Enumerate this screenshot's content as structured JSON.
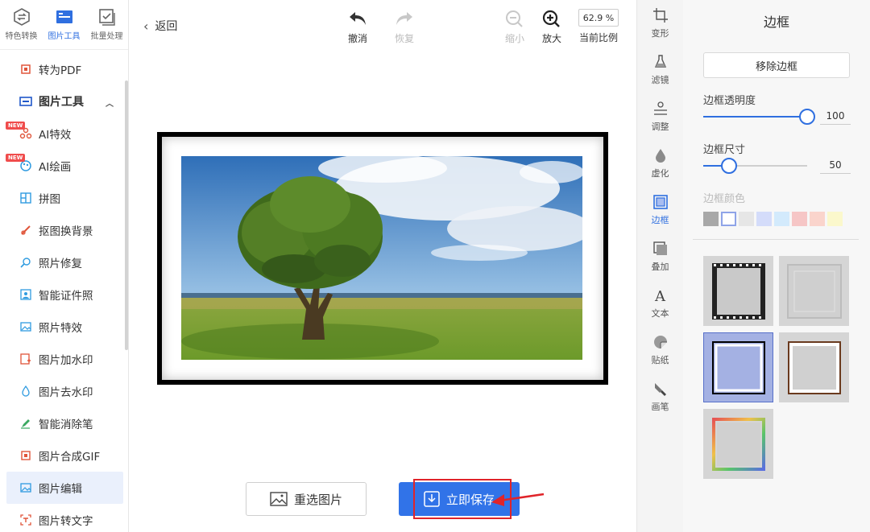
{
  "sidebar": {
    "top_tabs": [
      {
        "label": "特色转换",
        "icon": "convert-icon"
      },
      {
        "label": "图片工具",
        "icon": "image-tool-icon"
      },
      {
        "label": "批量处理",
        "icon": "batch-icon"
      }
    ],
    "items": [
      {
        "label": "转为PDF"
      },
      {
        "label": "图片工具"
      },
      {
        "label": "AI特效",
        "badge": "NEW"
      },
      {
        "label": "AI绘画",
        "badge": "NEW"
      },
      {
        "label": "拼图"
      },
      {
        "label": "抠图换背景"
      },
      {
        "label": "照片修复"
      },
      {
        "label": "智能证件照"
      },
      {
        "label": "照片特效"
      },
      {
        "label": "图片加水印"
      },
      {
        "label": "图片去水印"
      },
      {
        "label": "智能消除笔"
      },
      {
        "label": "图片合成GIF"
      },
      {
        "label": "图片编辑"
      },
      {
        "label": "图片转文字"
      }
    ]
  },
  "toolbar": {
    "back": "返回",
    "undo": "撤消",
    "redo": "恢复",
    "zoom_out": "缩小",
    "zoom_in": "放大",
    "zoom_value": "62.9 %",
    "zoom_label": "当前比例"
  },
  "canvas": {
    "reselect": "重选图片",
    "save": "立即保存"
  },
  "tools": [
    {
      "label": "变形",
      "icon": "transform-icon"
    },
    {
      "label": "滤镜",
      "icon": "filter-icon"
    },
    {
      "label": "调整",
      "icon": "adjust-icon"
    },
    {
      "label": "虚化",
      "icon": "blur-icon"
    },
    {
      "label": "边框",
      "icon": "border-icon"
    },
    {
      "label": "叠加",
      "icon": "overlay-icon"
    },
    {
      "label": "文本",
      "icon": "text-icon"
    },
    {
      "label": "贴纸",
      "icon": "sticker-icon"
    },
    {
      "label": "画笔",
      "icon": "brush-icon"
    }
  ],
  "panel": {
    "title": "边框",
    "remove": "移除边框",
    "opacity_label": "边框透明度",
    "opacity_value": "100",
    "opacity_level": 1.0,
    "size_label": "边框尺寸",
    "size_value": "50",
    "size_level": 0.25,
    "color_label": "边框颜色",
    "colors": [
      "#a8a8a8",
      "#ffffff",
      "#e6e6e6",
      "#d4dcfa",
      "#d3eafc",
      "#f6c6c6",
      "#fad4cc",
      "#fbf8cc"
    ]
  },
  "colors": {
    "accent": "#3173e8",
    "highlight": "#e0242a",
    "badge": "#f04c4c"
  }
}
